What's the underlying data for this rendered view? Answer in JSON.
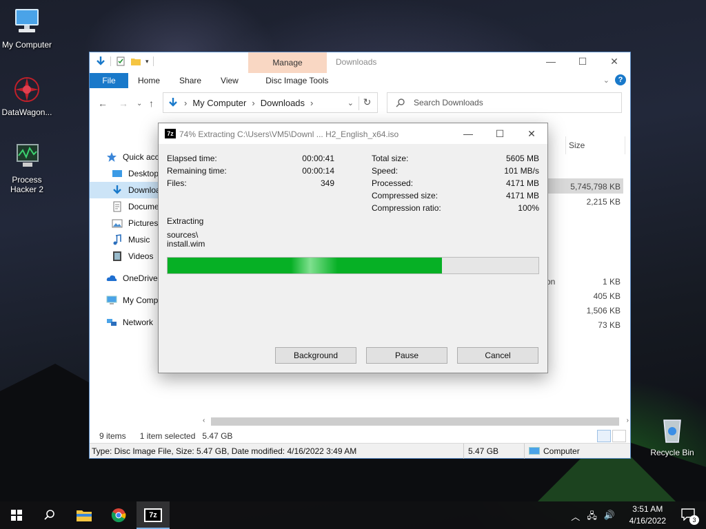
{
  "desktop": {
    "icons": [
      {
        "label": "My Computer"
      },
      {
        "label": "DataWagon..."
      },
      {
        "label": "Process Hacker 2"
      },
      {
        "label": "Recycle Bin"
      }
    ]
  },
  "explorer": {
    "title": "Downloads",
    "manage_tab": "Manage",
    "ribbon_tabs": [
      "File",
      "Home",
      "Share",
      "View",
      "Disc Image Tools"
    ],
    "address": {
      "parts": [
        "My Computer",
        "Downloads"
      ]
    },
    "search_placeholder": "Search Downloads",
    "sidebar": [
      {
        "label": "Quick access"
      },
      {
        "label": "Desktop"
      },
      {
        "label": "Downloads"
      },
      {
        "label": "Documents"
      },
      {
        "label": "Pictures"
      },
      {
        "label": "Music"
      },
      {
        "label": "Videos"
      },
      {
        "label": "OneDrive"
      },
      {
        "label": "My Computer"
      },
      {
        "label": "Network"
      }
    ],
    "column_size": "Size",
    "type_fragment": "on",
    "sizes": [
      "5,745,798 KB",
      "2,215 KB",
      "1 KB",
      "405 KB",
      "1,506 KB",
      "73 KB"
    ],
    "status": {
      "items": "9 items",
      "selected": "1 item selected",
      "selected_size": "5.47 GB",
      "details": "Type: Disc Image File, Size: 5.47 GB, Date modified: 4/16/2022 3:49 AM",
      "size": "5.47 GB",
      "location": "Computer"
    }
  },
  "dialog": {
    "title": "74% Extracting C:\\Users\\VM5\\Downl ... H2_English_x64.iso",
    "icon_text": "7z",
    "left": [
      {
        "label": "Elapsed time:",
        "value": "00:00:41"
      },
      {
        "label": "Remaining time:",
        "value": "00:00:14"
      },
      {
        "label": "Files:",
        "value": "349"
      }
    ],
    "right": [
      {
        "label": "Total size:",
        "value": "5605 MB"
      },
      {
        "label": "Speed:",
        "value": "101 MB/s"
      },
      {
        "label": "Processed:",
        "value": "4171 MB"
      },
      {
        "label": "Compressed size:",
        "value": "4171 MB"
      },
      {
        "label": "Compression ratio:",
        "value": "100%"
      }
    ],
    "status_label": "Extracting",
    "path_line1": "sources\\",
    "path_line2": "install.wim",
    "progress_percent": 74,
    "buttons": {
      "background": "Background",
      "pause": "Pause",
      "cancel": "Cancel"
    }
  },
  "taskbar": {
    "apps": [
      "start-icon",
      "search-icon",
      "file-explorer-icon",
      "chrome-icon",
      "7zip-icon"
    ],
    "time": "3:51 AM",
    "date": "4/16/2022",
    "notifications": "3",
    "seven_zip_label": "7z"
  }
}
